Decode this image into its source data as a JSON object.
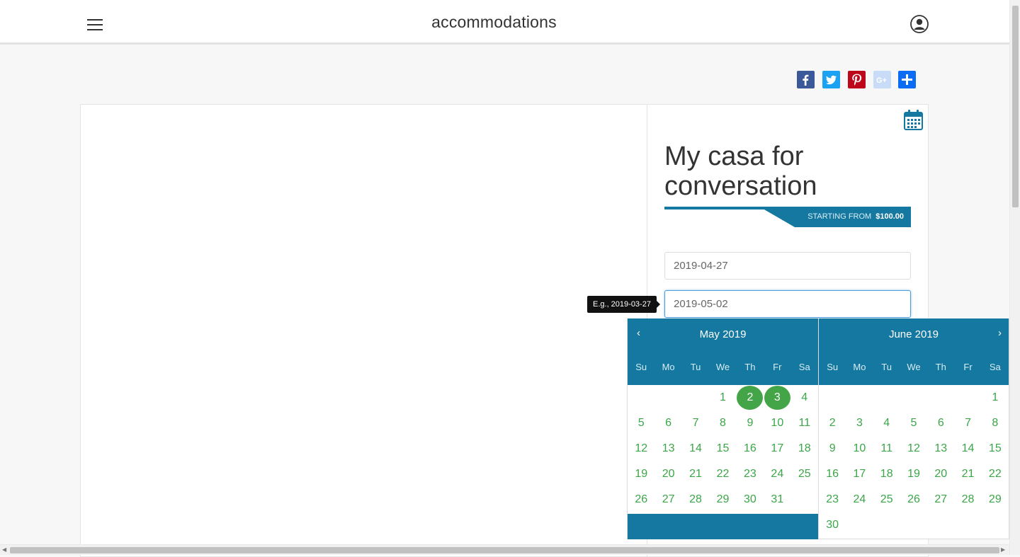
{
  "header": {
    "title": "accommodations"
  },
  "share": {
    "colors": {
      "facebook": "#3b5998",
      "twitter": "#1da1f2",
      "pinterest": "#bd081c",
      "googleplus": "#c8dcf7",
      "share": "#0a6cf5"
    }
  },
  "listing": {
    "title": "My casa for conversation",
    "price_label": "STARTING FROM",
    "price_value": "$100.00"
  },
  "booking": {
    "checkin_value": "2019-04-27",
    "checkout_value": "2019-05-02",
    "tooltip": "E.g., 2019-03-27"
  },
  "datepicker": {
    "weekdays": [
      "Su",
      "Mo",
      "Tu",
      "We",
      "Th",
      "Fr",
      "Sa"
    ],
    "months": [
      {
        "title": "May 2019",
        "weeks": [
          [
            "",
            "",
            "",
            "1",
            "2",
            "3",
            "4"
          ],
          [
            "5",
            "6",
            "7",
            "8",
            "9",
            "10",
            "11"
          ],
          [
            "12",
            "13",
            "14",
            "15",
            "16",
            "17",
            "18"
          ],
          [
            "19",
            "20",
            "21",
            "22",
            "23",
            "24",
            "25"
          ],
          [
            "26",
            "27",
            "28",
            "29",
            "30",
            "31",
            ""
          ]
        ],
        "selected": [
          "2",
          "3"
        ]
      },
      {
        "title": "June 2019",
        "weeks": [
          [
            "",
            "",
            "",
            "",
            "",
            "",
            "1"
          ],
          [
            "2",
            "3",
            "4",
            "5",
            "6",
            "7",
            "8"
          ],
          [
            "9",
            "10",
            "11",
            "12",
            "13",
            "14",
            "15"
          ],
          [
            "16",
            "17",
            "18",
            "19",
            "20",
            "21",
            "22"
          ],
          [
            "23",
            "24",
            "25",
            "26",
            "27",
            "28",
            "29"
          ],
          [
            "30",
            "",
            "",
            "",
            "",
            "",
            ""
          ]
        ],
        "selected": []
      }
    ],
    "header_color": "#1478a0",
    "day_color": "#3aa648",
    "selected_color": "#43a548"
  }
}
